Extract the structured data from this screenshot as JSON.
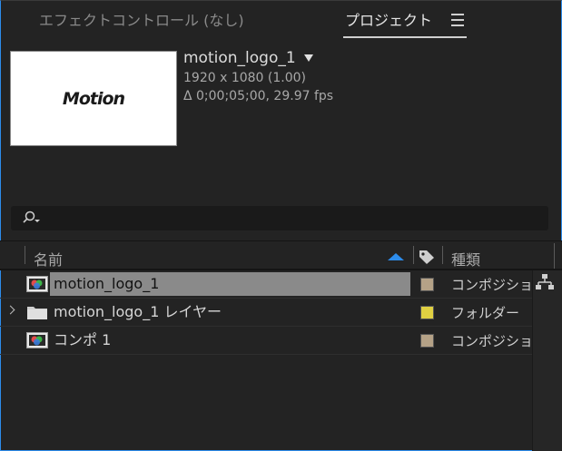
{
  "tabs": {
    "effects": "エフェクトコントロール (なし)",
    "project": "プロジェクト"
  },
  "preview": {
    "thumbnail_text": "Motion",
    "name": "motion_logo_1",
    "dimensions": "1920 x 1080 (1.00)",
    "duration": "Δ 0;00;05;00, 29.97 fps"
  },
  "search": {
    "placeholder": ""
  },
  "columns": {
    "name": "名前",
    "kind": "種類"
  },
  "items": [
    {
      "name": "motion_logo_1",
      "kind": "コンポジション",
      "icon": "composition-icon",
      "color": "#b5a287",
      "selected": true
    },
    {
      "name": "motion_logo_1 レイヤー",
      "kind": "フォルダー",
      "icon": "folder-icon",
      "color": "#e0d042",
      "selected": false
    },
    {
      "name": "コンポ 1",
      "kind": "コンポジション",
      "icon": "composition-icon",
      "color": "#b5a287",
      "selected": false
    }
  ],
  "colors": {
    "accent": "#2d8ceb",
    "selection": "#8a8a8a"
  }
}
